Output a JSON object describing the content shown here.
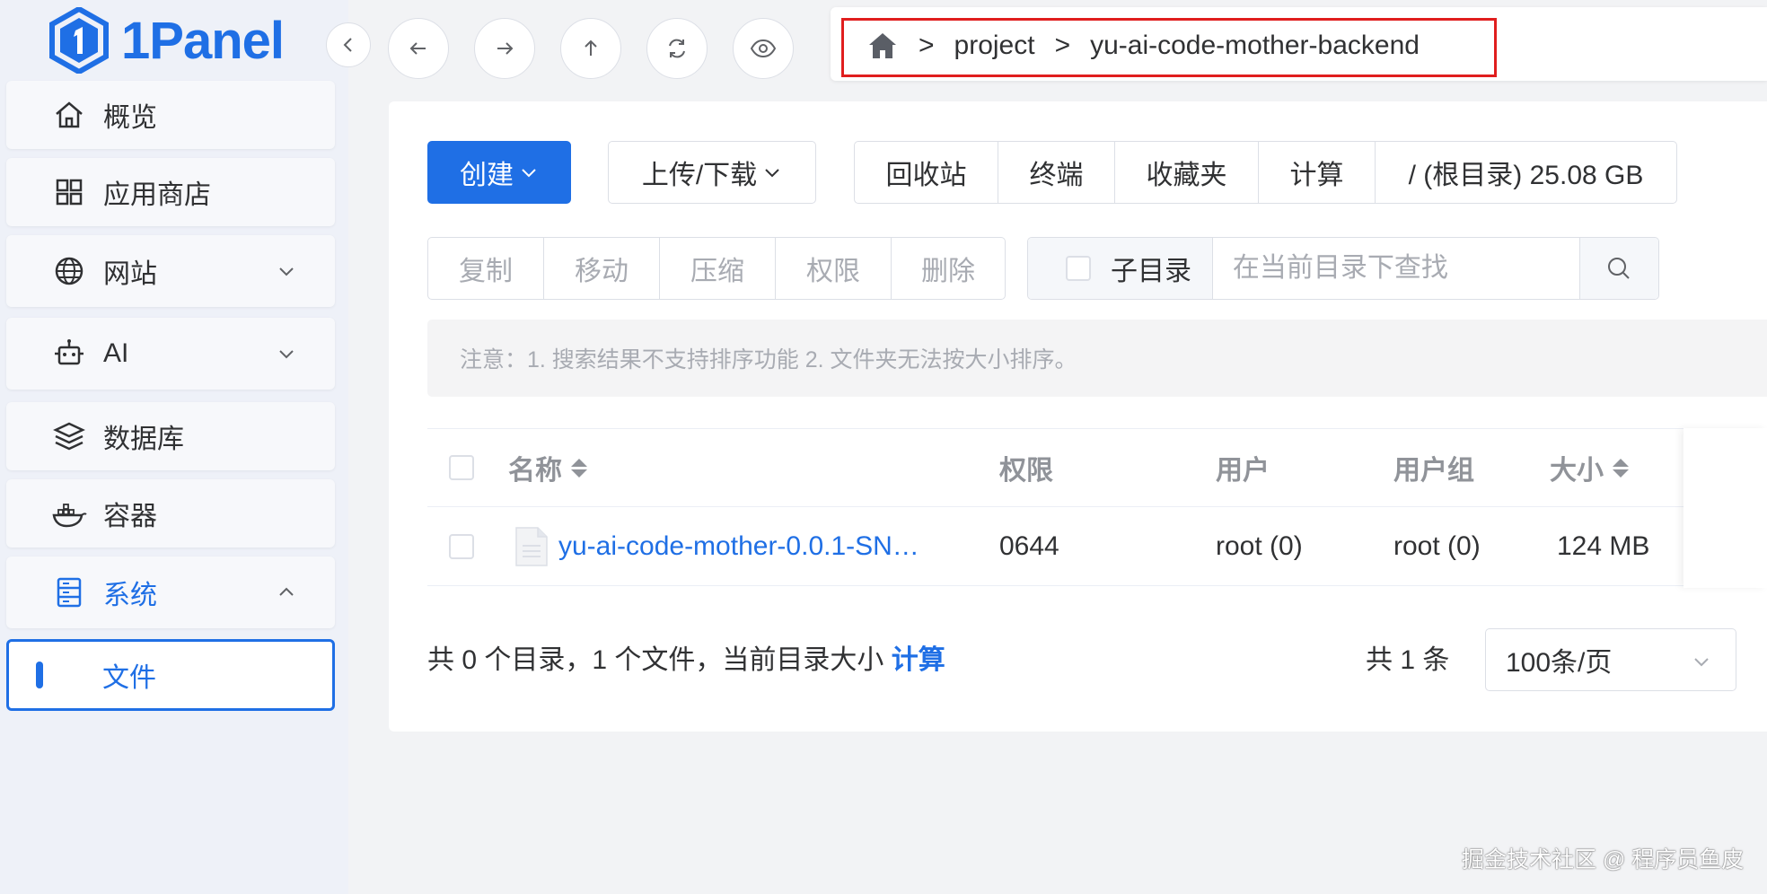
{
  "app": {
    "logo_text": "1Panel"
  },
  "sidebar": {
    "items": [
      {
        "label": "概览",
        "icon": "home-icon"
      },
      {
        "label": "应用商店",
        "icon": "grid-icon"
      },
      {
        "label": "网站",
        "icon": "globe-icon",
        "expandable": true
      },
      {
        "label": "AI",
        "icon": "robot-icon",
        "expandable": true
      },
      {
        "label": "数据库",
        "icon": "layers-icon"
      },
      {
        "label": "容器",
        "icon": "docker-icon"
      },
      {
        "label": "系统",
        "icon": "server-icon",
        "expanded": true
      },
      {
        "label": "文件",
        "active": true
      }
    ]
  },
  "breadcrumb": {
    "segments": [
      "project",
      "yu-ai-code-mother-backend"
    ],
    "separator": ">"
  },
  "toolbar": {
    "create_label": "创建",
    "upload_label": "上传/下载",
    "group": [
      "回收站",
      "终端",
      "收藏夹",
      "计算",
      "/ (根目录) 25.08 GB"
    ],
    "actions": [
      "复制",
      "移动",
      "压缩",
      "权限",
      "删除"
    ],
    "subdir_label": "子目录",
    "search_placeholder": "在当前目录下查找"
  },
  "notice": "注意：1. 搜索结果不支持排序功能 2. 文件夹无法按大小排序。",
  "table": {
    "headers": {
      "name": "名称",
      "perm": "权限",
      "user": "用户",
      "group": "用户组",
      "size": "大小"
    },
    "rows": [
      {
        "name": "yu-ai-code-mother-0.0.1-SN…",
        "perm": "0644",
        "user": "root (0)",
        "group": "root (0)",
        "size": "124 MB"
      }
    ]
  },
  "footer": {
    "summary": "共 0 个目录，1 个文件，当前目录大小",
    "calc_link": "计算",
    "total": "共 1 条",
    "page_size": "100条/页"
  },
  "watermark": "掘金技术社区 @ 程序员鱼皮",
  "colors": {
    "primary": "#1f6fe5",
    "highlight_border": "#e01e1e"
  }
}
